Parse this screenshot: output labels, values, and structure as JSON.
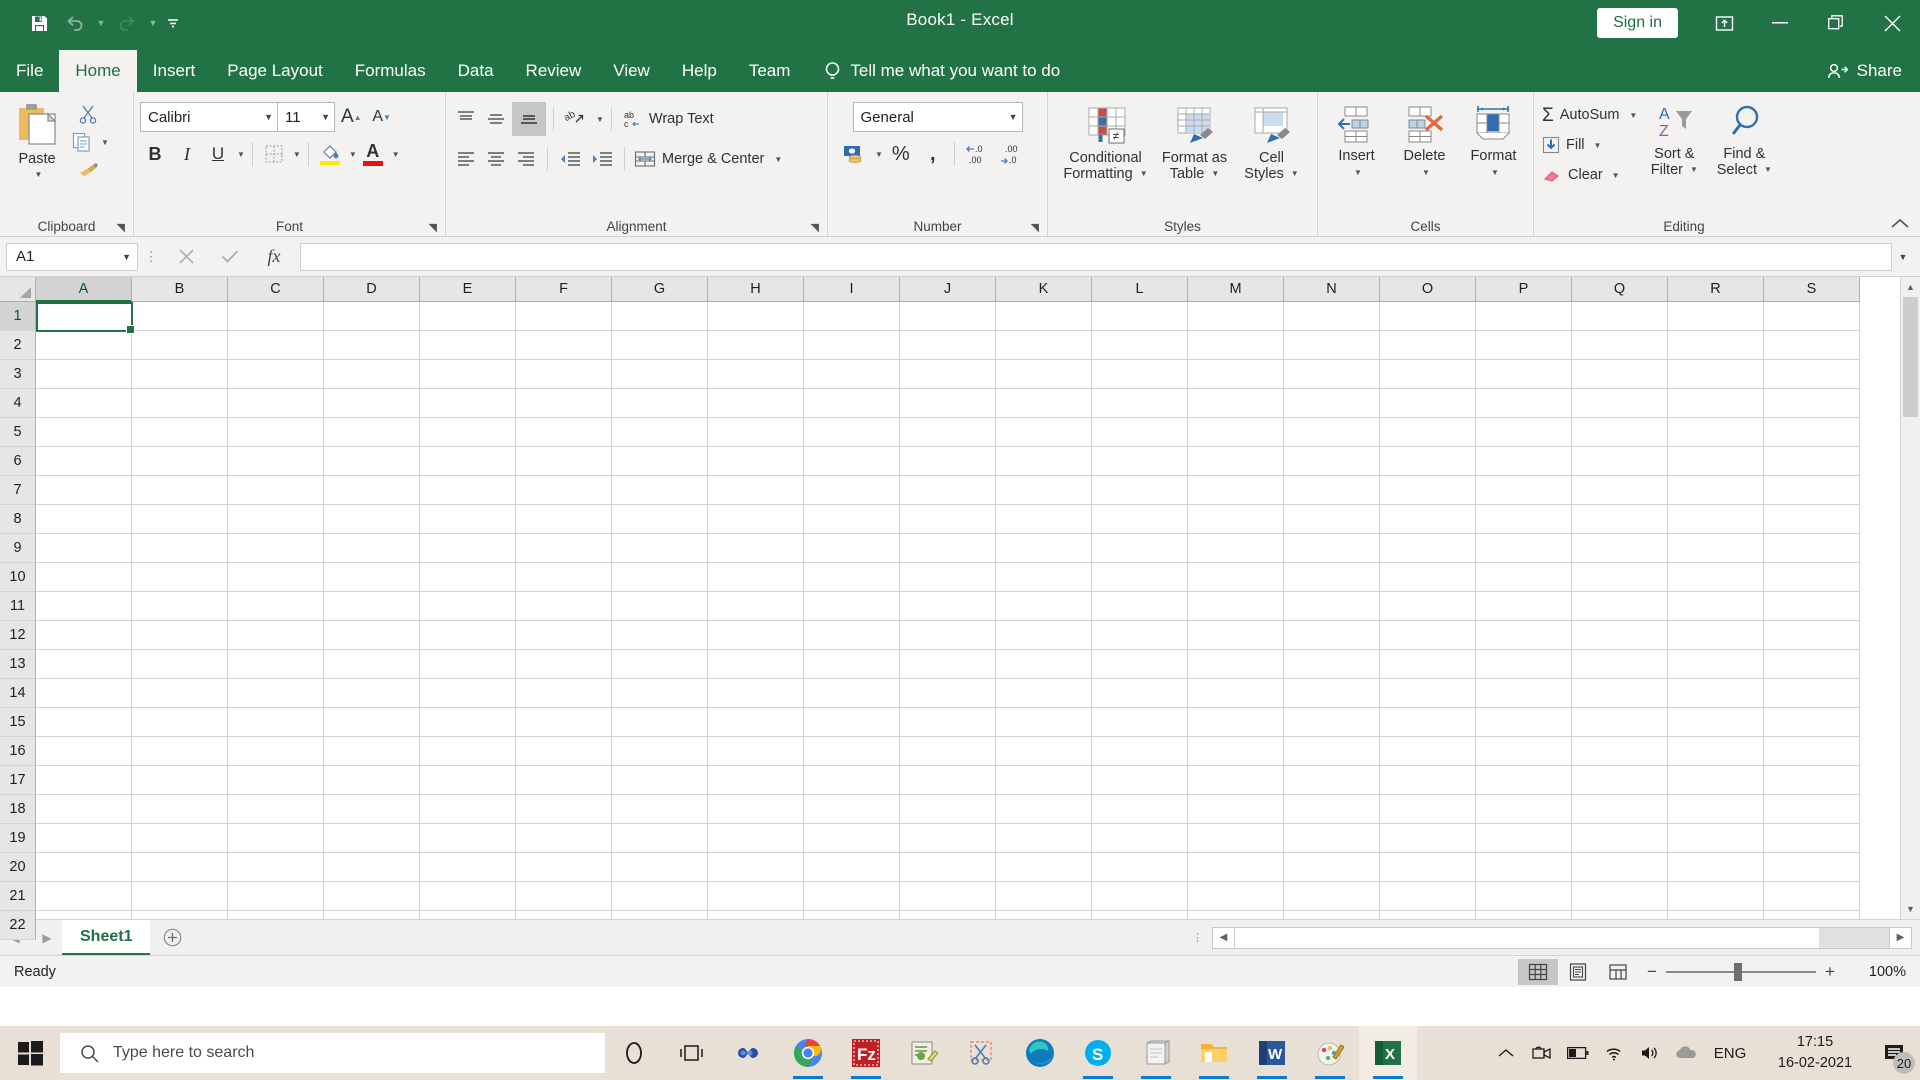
{
  "titlebar": {
    "quick_access": [
      {
        "name": "save-icon",
        "label": "Save"
      },
      {
        "name": "undo-icon",
        "label": "Undo"
      },
      {
        "name": "redo-icon",
        "label": "Redo"
      },
      {
        "name": "customize-quick-access-icon",
        "label": "Customize Quick Access Toolbar"
      }
    ],
    "title": "Book1  -  Excel",
    "sign_in_label": "Sign in",
    "window_buttons": [
      {
        "name": "ribbon-display-options-icon",
        "label": "Ribbon Display Options"
      },
      {
        "name": "minimize-icon",
        "label": "Minimize"
      },
      {
        "name": "restore-icon",
        "label": "Restore Down"
      },
      {
        "name": "close-icon",
        "label": "Close"
      }
    ]
  },
  "tabs": [
    {
      "label": "File",
      "active": false
    },
    {
      "label": "Home",
      "active": true
    },
    {
      "label": "Insert",
      "active": false
    },
    {
      "label": "Page Layout",
      "active": false
    },
    {
      "label": "Formulas",
      "active": false
    },
    {
      "label": "Data",
      "active": false
    },
    {
      "label": "Review",
      "active": false
    },
    {
      "label": "View",
      "active": false
    },
    {
      "label": "Help",
      "active": false
    },
    {
      "label": "Team",
      "active": false
    }
  ],
  "tellme": {
    "label": "Tell me what you want to do",
    "icon": "lightbulb-icon"
  },
  "share": {
    "label": "Share",
    "icon": "share-person-icon"
  },
  "ribbon": {
    "clipboard": {
      "group_label": "Clipboard",
      "paste_label": "Paste",
      "cut_label": "Cut",
      "copy_label": "Copy",
      "format_painter_label": "Format Painter"
    },
    "font": {
      "group_label": "Font",
      "font_family": "Calibri",
      "font_size": "11",
      "grow_font_label": "Increase Font Size",
      "shrink_font_label": "Decrease Font Size",
      "bold_label": "B",
      "italic_label": "I",
      "underline_label": "U",
      "borders_label": "Borders",
      "fill_color_label": "Fill Color",
      "font_color_label": "Font Color"
    },
    "alignment": {
      "group_label": "Alignment",
      "top_align_label": "Top Align",
      "middle_align_label": "Middle Align",
      "bottom_align_label": "Bottom Align",
      "orientation_label": "Orientation",
      "wrap_text_label": "Wrap Text",
      "align_left_label": "Align Left",
      "center_label": "Center",
      "align_right_label": "Align Right",
      "decrease_indent_label": "Decrease Indent",
      "increase_indent_label": "Increase Indent",
      "merge_center_label": "Merge & Center"
    },
    "number": {
      "group_label": "Number",
      "format": "General",
      "accounting_label": "Accounting Number Format",
      "percent_label": "%",
      "comma_label": ",",
      "increase_decimal_label": "Increase Decimal",
      "decrease_decimal_label": "Decrease Decimal"
    },
    "styles": {
      "group_label": "Styles",
      "conditional_formatting_label": "Conditional\nFormatting",
      "conditional_formatting_line1": "Conditional",
      "conditional_formatting_line2": "Formatting",
      "format_as_table_line1": "Format as",
      "format_as_table_line2": "Table",
      "cell_styles_line1": "Cell",
      "cell_styles_line2": "Styles"
    },
    "cells": {
      "group_label": "Cells",
      "insert_label": "Insert",
      "delete_label": "Delete",
      "format_label": "Format"
    },
    "editing": {
      "group_label": "Editing",
      "autosum_label": "AutoSum",
      "fill_label": "Fill",
      "clear_label": "Clear",
      "sort_filter_line1": "Sort &",
      "sort_filter_line2": "Filter",
      "find_select_line1": "Find &",
      "find_select_line2": "Select",
      "collapse_ribbon_label": "Collapse the Ribbon"
    }
  },
  "formula_bar": {
    "name_box_value": "A1",
    "cancel_label": "Cancel",
    "enter_label": "Enter",
    "insert_function_label": "fx",
    "formula_value": "",
    "expand_label": "Expand Formula Bar"
  },
  "grid": {
    "columns": [
      "A",
      "B",
      "C",
      "D",
      "E",
      "F",
      "G",
      "H",
      "I",
      "J",
      "K",
      "L",
      "M",
      "N",
      "O",
      "P",
      "Q",
      "R",
      "S"
    ],
    "rows": [
      1,
      2,
      3,
      4,
      5,
      6,
      7,
      8,
      9,
      10,
      11,
      12,
      13,
      14,
      15,
      16,
      17,
      18,
      19,
      20,
      21,
      22
    ],
    "active_cell": "A1",
    "selected_column": "A",
    "selected_row": 1
  },
  "sheetbar": {
    "prev_label": "Previous Sheet",
    "next_label": "Next Sheet",
    "sheets": [
      {
        "name": "Sheet1",
        "active": true
      }
    ],
    "add_sheet_label": "New sheet"
  },
  "statusbar": {
    "status": "Ready",
    "views": [
      {
        "name": "normal-view-icon",
        "label": "Normal",
        "active": true
      },
      {
        "name": "page-layout-view-icon",
        "label": "Page Layout",
        "active": false
      },
      {
        "name": "page-break-preview-icon",
        "label": "Page Break Preview",
        "active": false
      }
    ],
    "zoom_out_label": "Zoom Out",
    "zoom_in_label": "Zoom In",
    "zoom_level": "100%"
  },
  "taskbar": {
    "start_label": "Start",
    "search_placeholder": "Type here to search",
    "search_icon": "search-icon",
    "apps": [
      {
        "name": "cortana-icon",
        "label": "Cortana",
        "running": false
      },
      {
        "name": "task-view-icon",
        "label": "Task View",
        "running": false
      },
      {
        "name": "infinity-app-icon",
        "label": "Infinity",
        "running": false
      },
      {
        "name": "google-chrome-icon",
        "label": "Google Chrome",
        "running": true
      },
      {
        "name": "filezilla-icon",
        "label": "FileZilla",
        "running": true
      },
      {
        "name": "notepadpp-icon",
        "label": "Notepad++",
        "running": false
      },
      {
        "name": "snipping-tool-icon",
        "label": "Snipping Tool",
        "running": false
      },
      {
        "name": "microsoft-edge-icon",
        "label": "Microsoft Edge",
        "running": false
      },
      {
        "name": "skype-icon",
        "label": "Skype",
        "running": true
      },
      {
        "name": "notepad-icon",
        "label": "Notepad",
        "running": true
      },
      {
        "name": "file-explorer-icon",
        "label": "File Explorer",
        "running": true
      },
      {
        "name": "microsoft-word-icon",
        "label": "Microsoft Word",
        "running": true
      },
      {
        "name": "paint-icon",
        "label": "Paint",
        "running": true
      },
      {
        "name": "microsoft-excel-icon",
        "label": "Microsoft Excel",
        "running": true,
        "active": true
      }
    ],
    "tray": [
      {
        "name": "show-hidden-icons-icon",
        "label": "Show hidden icons"
      },
      {
        "name": "camera-icon",
        "label": "Camera"
      },
      {
        "name": "battery-icon",
        "label": "Battery"
      },
      {
        "name": "wifi-icon",
        "label": "Network"
      },
      {
        "name": "volume-icon",
        "label": "Speakers"
      },
      {
        "name": "onedrive-icon",
        "label": "OneDrive"
      }
    ],
    "language": "ENG",
    "time": "17:15",
    "date": "16-02-2021",
    "notification_count": "20"
  },
  "colors": {
    "excel_green": "#217346",
    "ribbon_bg": "#f3f2f1",
    "grid_line": "#d4d4d4",
    "header_bg": "#e6e6e6",
    "taskbar_bg": "#e8e0d5",
    "accent_blue": "#0a7bd4"
  }
}
